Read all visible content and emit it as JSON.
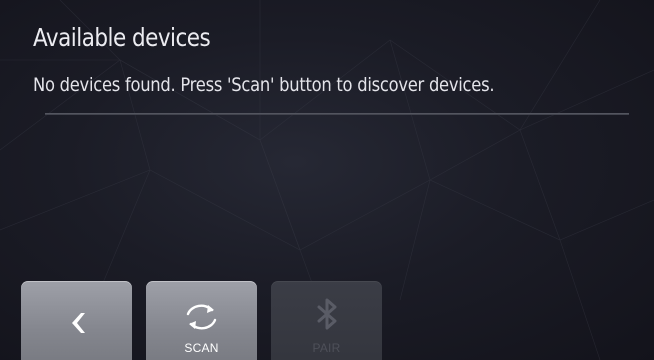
{
  "header": {
    "title": "Available devices"
  },
  "status": {
    "message": "No devices found. Press 'Scan' button to discover devices."
  },
  "toolbar": {
    "back": {
      "icon": "chevron-left-icon"
    },
    "scan": {
      "label": "SCAN",
      "icon": "refresh-icon"
    },
    "pair": {
      "label": "PAIR",
      "icon": "bluetooth-icon",
      "enabled": false
    }
  },
  "colors": {
    "background": "#1b1c26",
    "button": "#8c8e96",
    "button_disabled": "#363840",
    "text": "#ececf1",
    "disabled_icon": "#5a5c66"
  }
}
